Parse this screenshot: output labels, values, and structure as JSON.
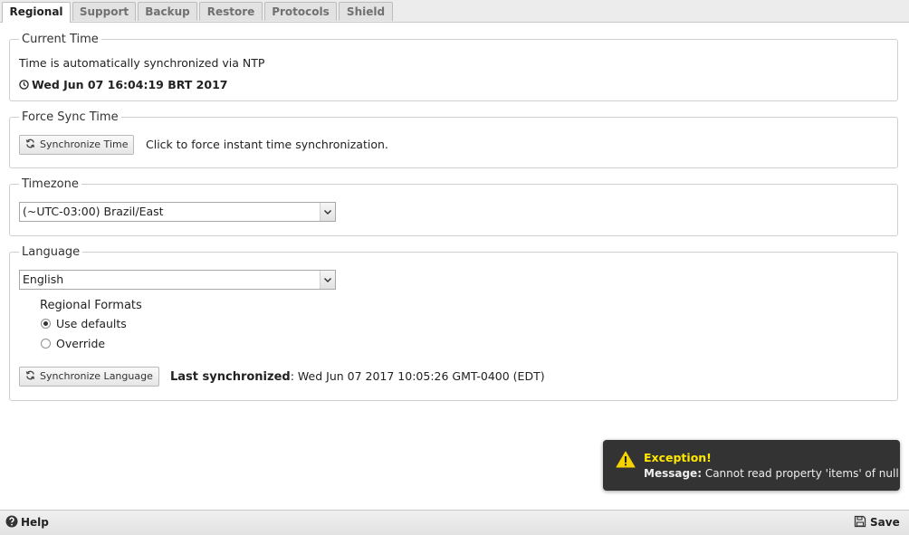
{
  "tabs": [
    {
      "label": "Regional",
      "active": true
    },
    {
      "label": "Support"
    },
    {
      "label": "Backup"
    },
    {
      "label": "Restore"
    },
    {
      "label": "Protocols"
    },
    {
      "label": "Shield"
    }
  ],
  "current_time": {
    "legend": "Current Time",
    "sync_text": "Time is automatically synchronized via NTP",
    "clock_icon": "clock-icon",
    "time_value": "Wed Jun 07 16:04:19 BRT 2017"
  },
  "force_sync": {
    "legend": "Force Sync Time",
    "button_label": "Synchronize Time",
    "button_icon": "refresh-icon",
    "description": "Click to force instant time synchronization."
  },
  "timezone": {
    "legend": "Timezone",
    "selected": "(~UTC-03:00) Brazil/East"
  },
  "language": {
    "legend": "Language",
    "selected": "English",
    "regional_formats_label": "Regional Formats",
    "options": [
      {
        "label": "Use defaults",
        "checked": true
      },
      {
        "label": "Override",
        "checked": false
      }
    ],
    "sync_button_label": "Synchronize Language",
    "last_sync_label": "Last synchronized",
    "last_sync_value": ": Wed Jun 07 2017 10:05:26 GMT-0400 (EDT)"
  },
  "toast": {
    "icon": "warning-icon",
    "title": "Exception!",
    "message_label": "Message:",
    "message_text": "Cannot read property 'items' of null",
    "colors": {
      "background": "#333333",
      "title": "#ffe800",
      "icon": "#f5d300"
    }
  },
  "footer": {
    "help_label": "Help",
    "help_icon": "help-icon",
    "save_label": "Save",
    "save_icon": "save-icon"
  }
}
